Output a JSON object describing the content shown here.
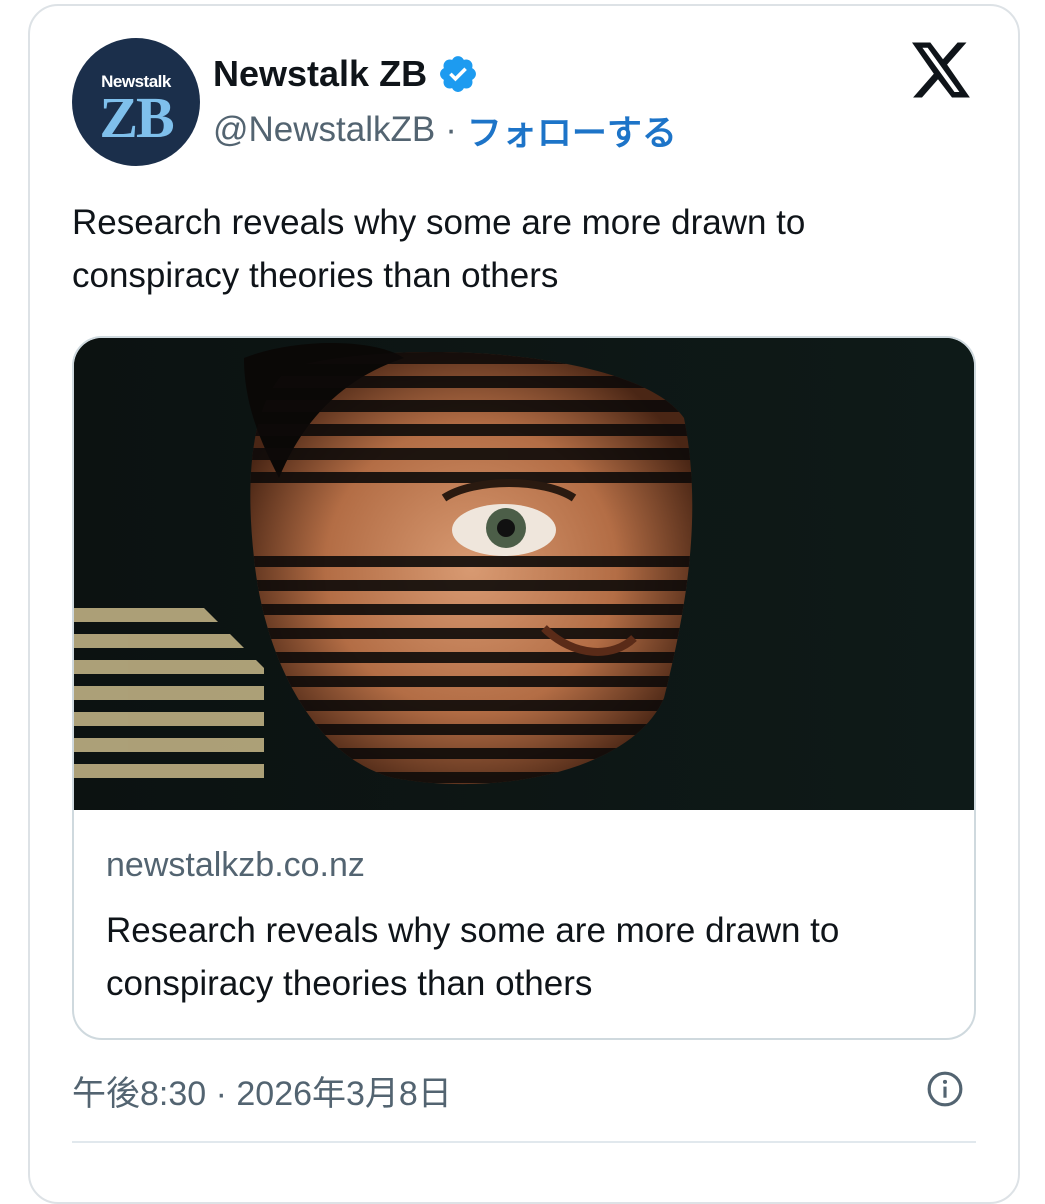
{
  "account": {
    "avatar_top_text": "Newstalk",
    "avatar_main_text": "ZB",
    "name": "Newstalk ZB",
    "handle": "@NewstalkZB",
    "separator": "·",
    "follow_label": "フォローする",
    "verified_icon": "verified-badge-icon",
    "platform_icon": "x-logo-icon"
  },
  "tweet": {
    "text": "Research reveals why some are more drawn to conspiracy theories than others"
  },
  "link_card": {
    "image_icon": "photo-face-striped-light",
    "domain": "newstalkzb.co.nz",
    "title": "Research reveals why some are more drawn to conspiracy theories than others"
  },
  "footer": {
    "timestamp": "午後8:30 · 2026年3月8日",
    "info_icon": "info-icon"
  },
  "colors": {
    "follow": "#1d74c8",
    "verified": "#1d9bf0",
    "muted_text": "#536471",
    "border": "#cfd9de"
  }
}
